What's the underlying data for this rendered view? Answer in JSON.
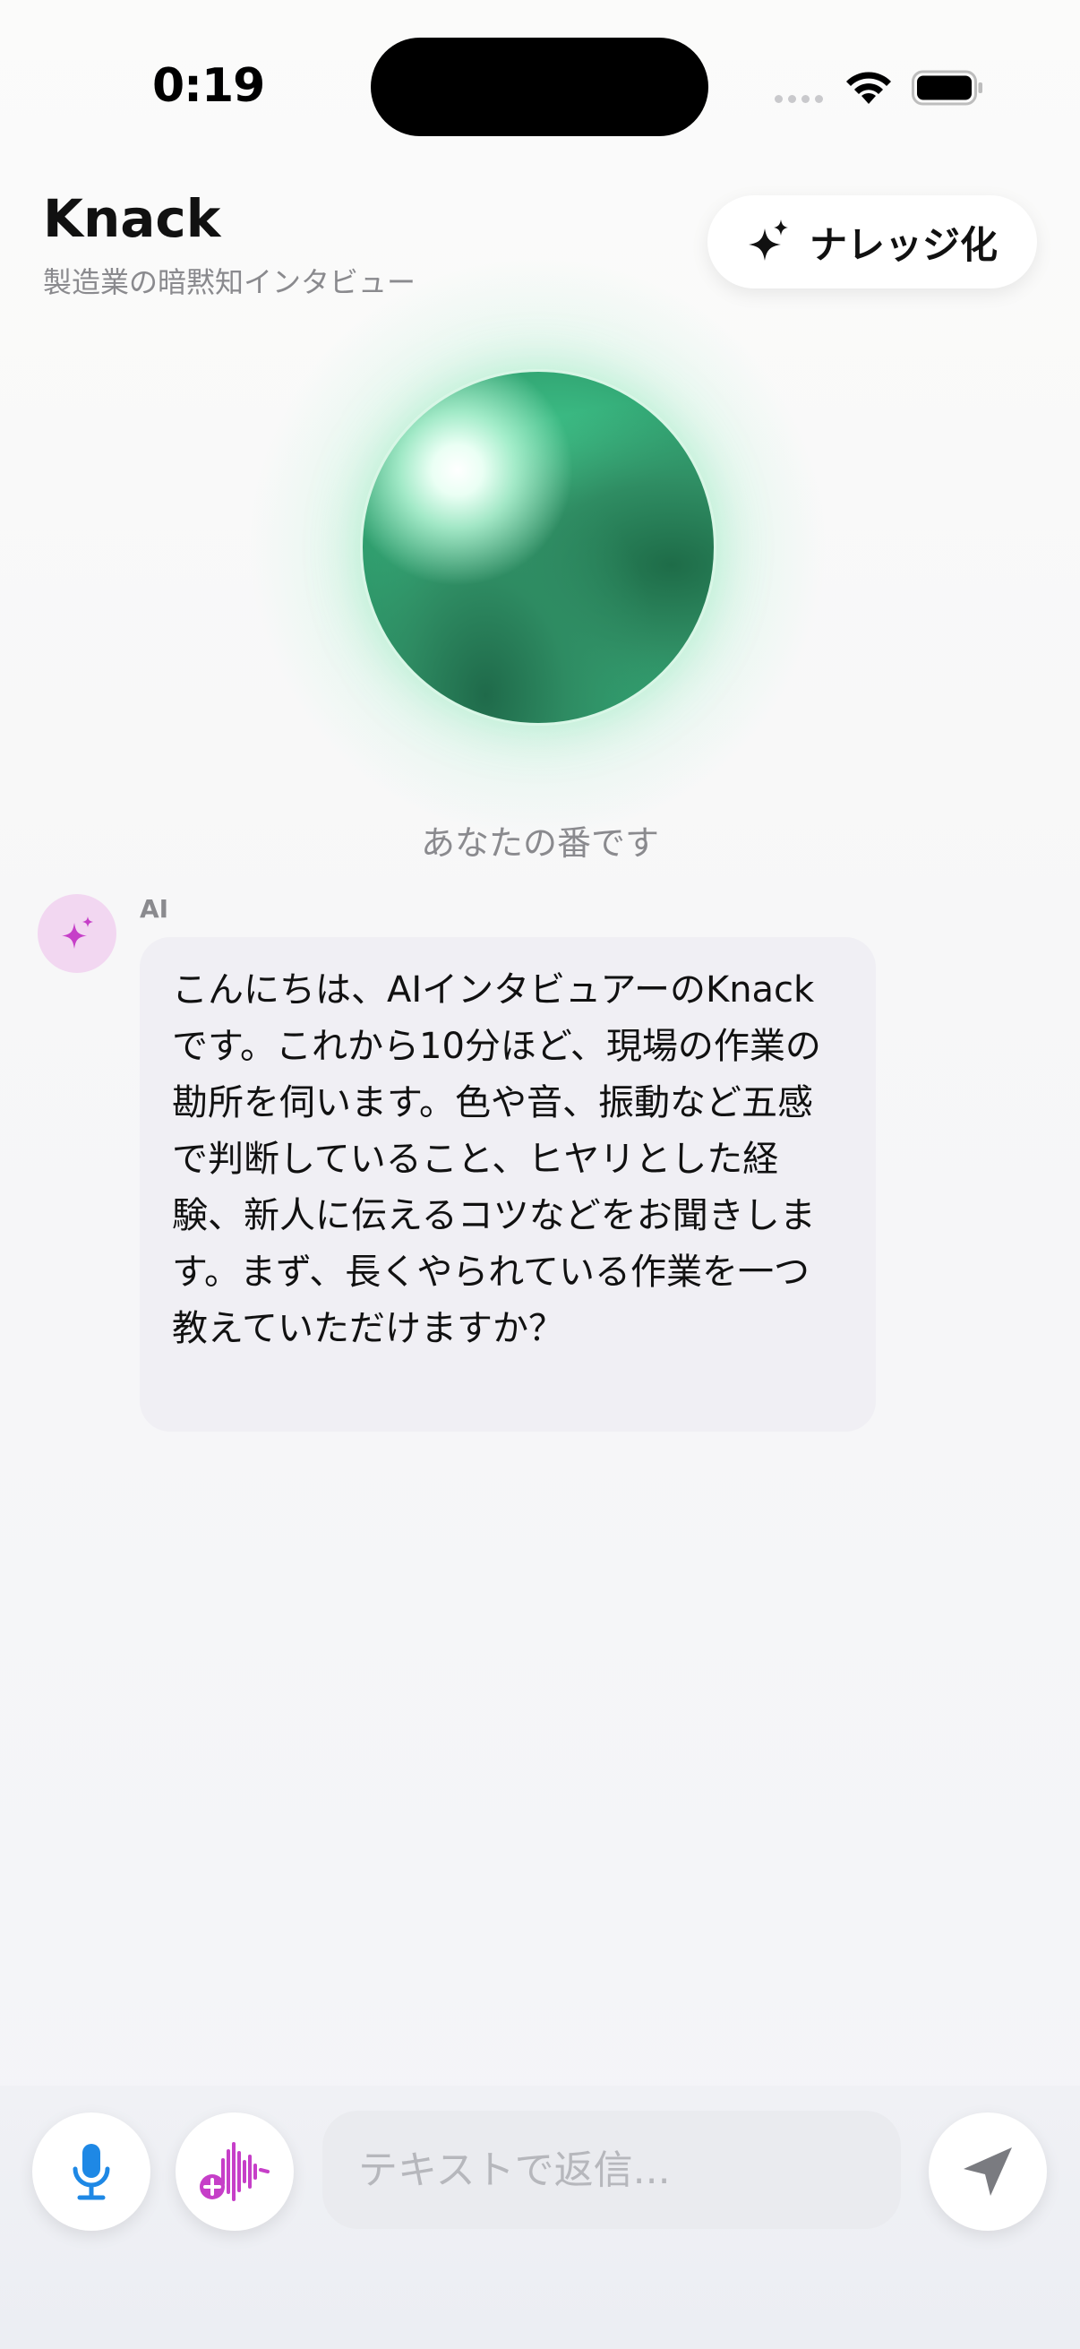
{
  "status_bar": {
    "time": "0:19",
    "icons": [
      "signal-icon",
      "wifi-icon",
      "battery-icon"
    ]
  },
  "header": {
    "title": "Knack",
    "subtitle": "製造業の暗黙知インタビュー",
    "knowledge_button": {
      "label": "ナレッジ化",
      "icon": "sparkle-icon"
    }
  },
  "orb": {
    "status_text": "あなたの番です"
  },
  "messages": [
    {
      "sender": "AI",
      "avatar_icon": "sparkle-icon",
      "text": "こんにちは、AIインタビュアーのKnackです。これから10分ほど、現場の作業の勘所を伺います。色や音、振動など五感で判断していること、ヒヤリとした経験、新人に伝えるコツなどをお聞きします。まず、長くやられている作業を一つ教えていただけますか？"
    }
  ],
  "input_bar": {
    "placeholder": "テキストで返信...",
    "value": "",
    "mic_icon": "microphone-icon",
    "voice_icon": "voice-add-icon",
    "send_icon": "send-icon"
  },
  "colors": {
    "orb_green": "#3fc38a",
    "mic_blue": "#1e88e5",
    "voice_magenta": "#c63fc8",
    "avatar_bg": "#f2d7f1"
  }
}
